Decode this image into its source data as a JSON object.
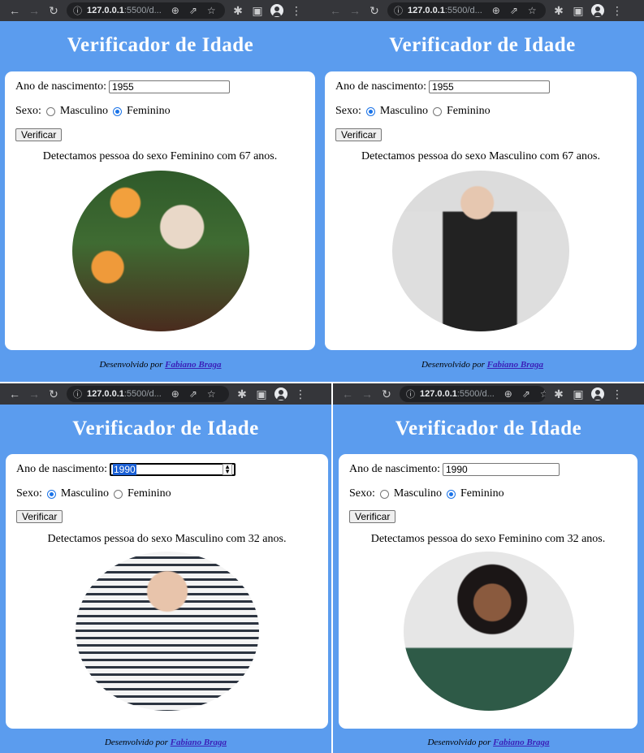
{
  "browser": {
    "url_host": "127.0.0.1",
    "url_rest": ":5500/d..."
  },
  "app": {
    "title": "Verificador de Idade",
    "year_label": "Ano de nascimento:",
    "sex_label": "Sexo:",
    "male_label": "Masculino",
    "female_label": "Feminino",
    "button_label": "Verificar",
    "footer_prefix": "Desenvolvido por",
    "footer_author": "Fabiano Braga"
  },
  "panels": [
    {
      "year": "1955",
      "selected_sex": "Feminino",
      "result": "Detectamos pessoa do sexo Feminino com 67 anos.",
      "photo": "elderly-woman-photo"
    },
    {
      "year": "1955",
      "selected_sex": "Masculino",
      "result": "Detectamos pessoa do sexo Masculino com 67 anos.",
      "photo": "elderly-man-photo"
    },
    {
      "year": "1990",
      "selected_sex": "Masculino",
      "result": "Detectamos pessoa do sexo Masculino com 32 anos.",
      "photo": "young-man-photo"
    },
    {
      "year": "1990",
      "selected_sex": "Feminino",
      "result": "Detectamos pessoa do sexo Feminino com 32 anos.",
      "photo": "young-woman-photo"
    }
  ],
  "icons": [
    "back-arrow-icon",
    "forward-arrow-icon",
    "reload-icon",
    "info-icon",
    "zoom-icon",
    "share-icon",
    "star-icon",
    "extensions-icon",
    "sidepanel-icon",
    "profile-icon",
    "menu-icon"
  ],
  "colors": {
    "page_bg": "#5b9cee",
    "chrome_bar": "#35363a",
    "author_link": "#3a1fb8",
    "radio_on": "#1a73e8"
  }
}
